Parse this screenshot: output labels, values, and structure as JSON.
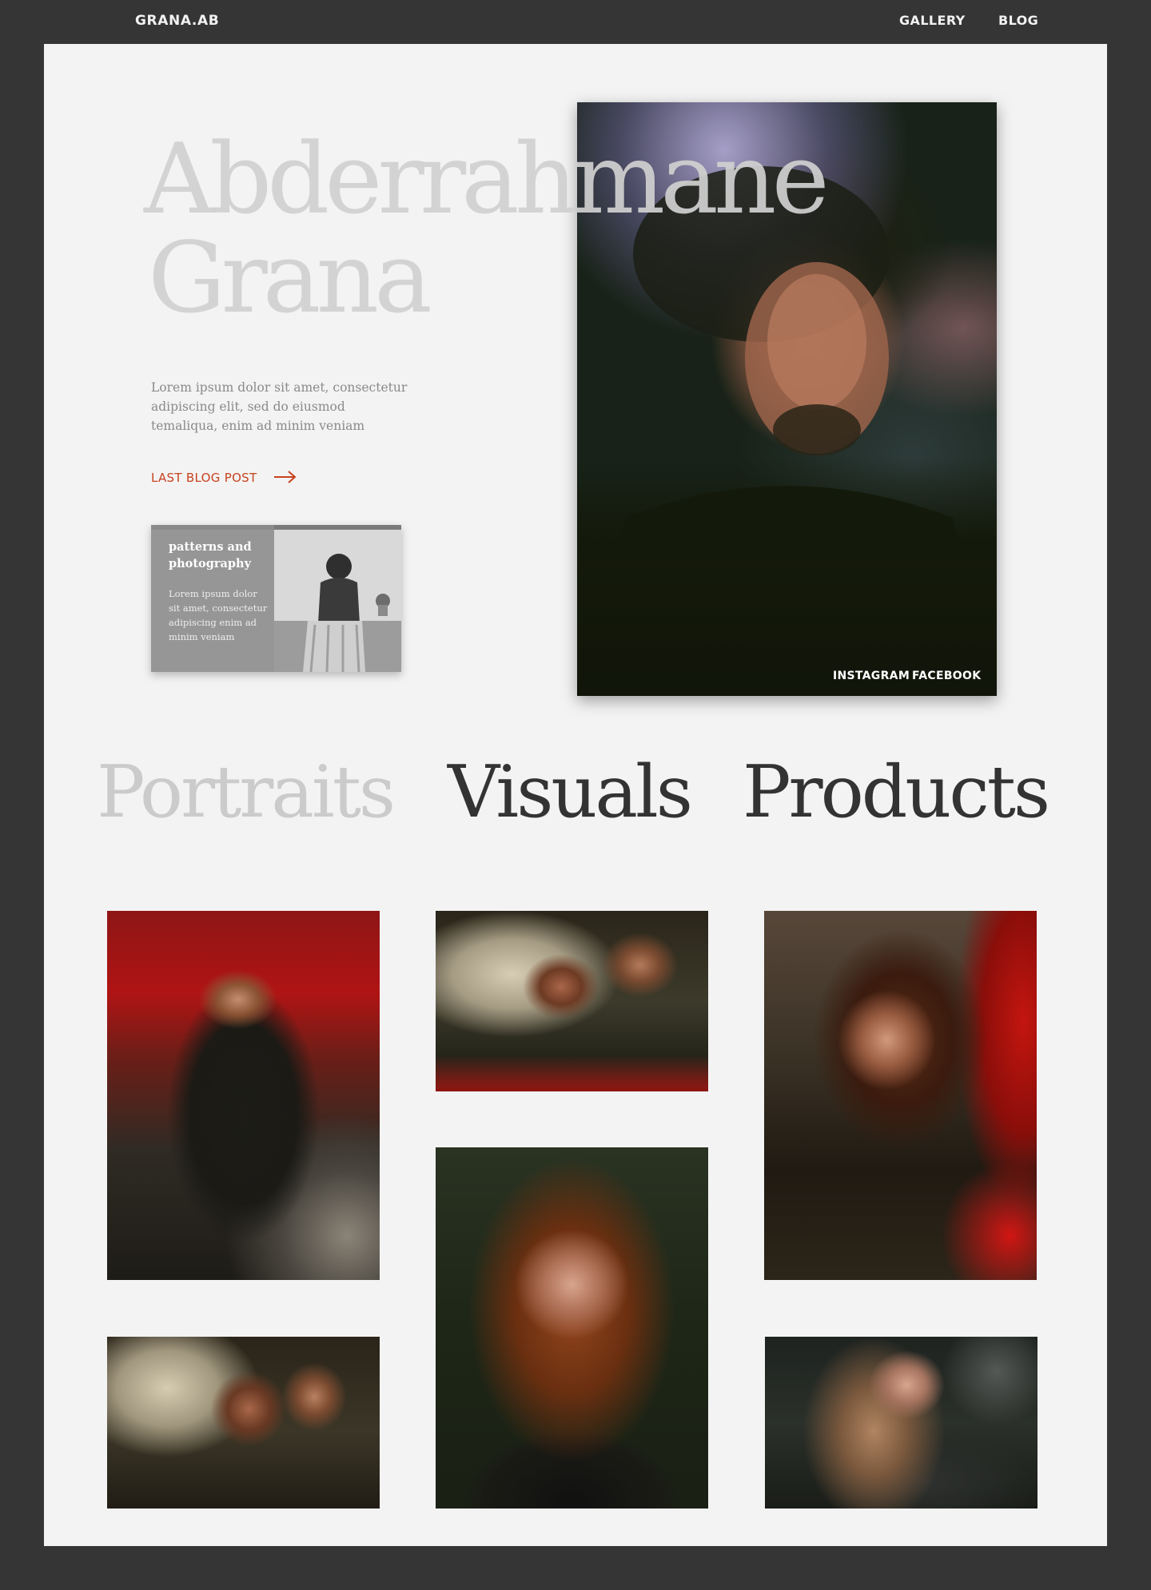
{
  "header": {
    "logo": "GRANA.AB",
    "nav": [
      {
        "label": "GALLERY"
      },
      {
        "label": "BLOG"
      }
    ]
  },
  "hero": {
    "name_first": "Abderrahmane",
    "name_last": "Grana",
    "intro": "Lorem ipsum dolor sit amet, consectetur adipiscing elit, sed do eiusmod temaliqua, enim ad minim veniam",
    "blog_link_label": "LAST BLOG POST",
    "blog_card": {
      "title": "patterns and photography",
      "text": "Lorem ipsum dolor sit amet, consectetur adipiscing enim ad minim veniam"
    },
    "social": [
      {
        "label": "INSTAGRAM"
      },
      {
        "label": "FACEBOOK"
      }
    ]
  },
  "categories": [
    {
      "label": "Portraits",
      "active": false
    },
    {
      "label": "Visuals",
      "active": true
    },
    {
      "label": "Products",
      "active": true
    }
  ],
  "colors": {
    "frame": "#353535",
    "panel": "#f3f3f3",
    "accent": "#c8421f",
    "muted_heading": "#cbcbcb",
    "dark_heading": "#333333"
  },
  "icons": {
    "blog_link": "arrow-right-icon"
  }
}
